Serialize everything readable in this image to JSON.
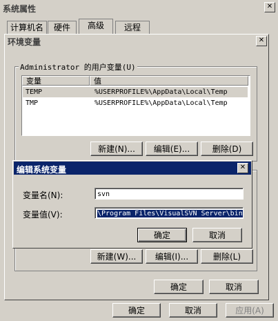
{
  "sysprops": {
    "title": "系统属性",
    "tabs": [
      "计算机名",
      "硬件",
      "高级",
      "远程"
    ],
    "ok": "确定",
    "cancel": "取消",
    "apply": "应用(A)"
  },
  "envvars": {
    "title": "环境变量",
    "user_group_label": "Administrator 的用户变量(U)",
    "columns": [
      "变量",
      "值"
    ],
    "rows": [
      {
        "name": "TEMP",
        "value": "%USERPROFILE%\\AppData\\Local\\Temp"
      },
      {
        "name": "TMP",
        "value": "%USERPROFILE%\\AppData\\Local\\Temp"
      }
    ],
    "new_btn": "新建(N)...",
    "edit_btn": "编辑(E)...",
    "delete_btn": "删除(D)",
    "sys_new_btn": "新建(W)...",
    "sys_edit_btn": "编辑(I)...",
    "sys_delete_btn": "删除(L)",
    "ok": "确定",
    "cancel": "取消"
  },
  "editdlg": {
    "title": "编辑系统变量",
    "name_label": "变量名(N):",
    "name_value": "svn",
    "value_label": "变量值(V):",
    "value_value": "\\Program Files\\VisualSVN Server\\bin",
    "ok": "确定",
    "cancel": "取消"
  },
  "colors": {
    "active_title": "#0a246a",
    "inactive_title": "#d4d0c8",
    "selection": "#0a246a"
  }
}
